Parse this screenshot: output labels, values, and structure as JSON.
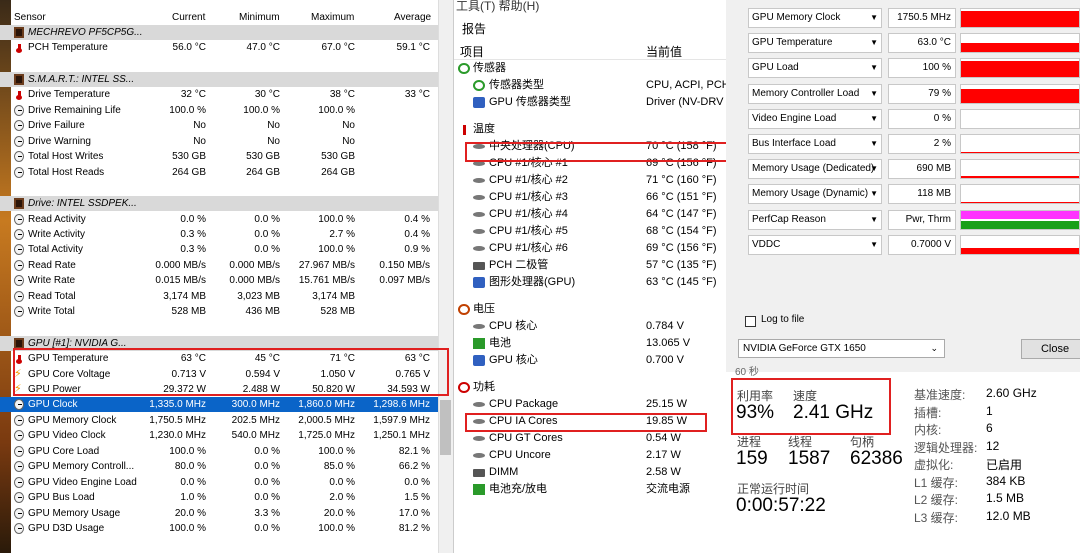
{
  "hwinfo": {
    "headers": {
      "sensor": "Sensor",
      "current": "Current",
      "min": "Minimum",
      "max": "Maximum",
      "avg": "Average"
    },
    "rows": [
      {
        "type": "grp",
        "name": "MECHREVO PF5CP5G...",
        "icon": "device-icon"
      },
      {
        "type": "row",
        "name": "PCH Temperature",
        "icon": "thermometer-icon",
        "cur": "56.0 °C",
        "min": "47.0 °C",
        "max": "67.0 °C",
        "avg": "59.1 °C"
      },
      {
        "type": "grp",
        "name": "S.M.A.R.T.: INTEL SS...",
        "icon": "device-icon"
      },
      {
        "type": "row",
        "name": "Drive Temperature",
        "icon": "thermometer-icon",
        "cur": "32 °C",
        "min": "30 °C",
        "max": "38 °C",
        "avg": "33 °C"
      },
      {
        "type": "row",
        "name": "Drive Remaining Life",
        "icon": "gauge-icon",
        "cur": "100.0 %",
        "min": "100.0 %",
        "max": "100.0 %",
        "avg": ""
      },
      {
        "type": "row",
        "name": "Drive Failure",
        "icon": "gauge-icon",
        "cur": "No",
        "min": "No",
        "max": "No",
        "avg": ""
      },
      {
        "type": "row",
        "name": "Drive Warning",
        "icon": "gauge-icon",
        "cur": "No",
        "min": "No",
        "max": "No",
        "avg": ""
      },
      {
        "type": "row",
        "name": "Total Host Writes",
        "icon": "gauge-icon",
        "cur": "530 GB",
        "min": "530 GB",
        "max": "530 GB",
        "avg": ""
      },
      {
        "type": "row",
        "name": "Total Host Reads",
        "icon": "gauge-icon",
        "cur": "264 GB",
        "min": "264 GB",
        "max": "264 GB",
        "avg": ""
      },
      {
        "type": "grp",
        "name": "Drive: INTEL SSDPEK...",
        "icon": "device-icon"
      },
      {
        "type": "row",
        "name": "Read Activity",
        "icon": "gauge-icon",
        "cur": "0.0 %",
        "min": "0.0 %",
        "max": "100.0 %",
        "avg": "0.4 %"
      },
      {
        "type": "row",
        "name": "Write Activity",
        "icon": "gauge-icon",
        "cur": "0.3 %",
        "min": "0.0 %",
        "max": "2.7 %",
        "avg": "0.4 %"
      },
      {
        "type": "row",
        "name": "Total Activity",
        "icon": "gauge-icon",
        "cur": "0.3 %",
        "min": "0.0 %",
        "max": "100.0 %",
        "avg": "0.9 %"
      },
      {
        "type": "row",
        "name": "Read Rate",
        "icon": "gauge-icon",
        "cur": "0.000 MB/s",
        "min": "0.000 MB/s",
        "max": "27.967 MB/s",
        "avg": "0.150 MB/s"
      },
      {
        "type": "row",
        "name": "Write Rate",
        "icon": "gauge-icon",
        "cur": "0.015 MB/s",
        "min": "0.000 MB/s",
        "max": "15.761 MB/s",
        "avg": "0.097 MB/s"
      },
      {
        "type": "row",
        "name": "Read Total",
        "icon": "gauge-icon",
        "cur": "3,174 MB",
        "min": "3,023 MB",
        "max": "3,174 MB",
        "avg": ""
      },
      {
        "type": "row",
        "name": "Write Total",
        "icon": "gauge-icon",
        "cur": "528 MB",
        "min": "436 MB",
        "max": "528 MB",
        "avg": ""
      },
      {
        "type": "grp",
        "name": "GPU [#1]: NVIDIA G...",
        "icon": "device-icon"
      },
      {
        "type": "row",
        "name": "GPU Temperature",
        "icon": "thermometer-icon",
        "cur": "63 °C",
        "min": "45 °C",
        "max": "71 °C",
        "avg": "63 °C"
      },
      {
        "type": "row",
        "name": "GPU Core Voltage",
        "icon": "bolt-icon",
        "cur": "0.713 V",
        "min": "0.594 V",
        "max": "1.050 V",
        "avg": "0.765 V"
      },
      {
        "type": "row",
        "name": "GPU Power",
        "icon": "bolt-icon",
        "cur": "29.372 W",
        "min": "2.488 W",
        "max": "50.820 W",
        "avg": "34.593 W"
      },
      {
        "type": "sel",
        "name": "GPU Clock",
        "icon": "gauge-icon",
        "cur": "1,335.0 MHz",
        "min": "300.0 MHz",
        "max": "1,860.0 MHz",
        "avg": "1,298.6 MHz"
      },
      {
        "type": "row",
        "name": "GPU Memory Clock",
        "icon": "gauge-icon",
        "cur": "1,750.5 MHz",
        "min": "202.5 MHz",
        "max": "2,000.5 MHz",
        "avg": "1,597.9 MHz"
      },
      {
        "type": "row",
        "name": "GPU Video Clock",
        "icon": "gauge-icon",
        "cur": "1,230.0 MHz",
        "min": "540.0 MHz",
        "max": "1,725.0 MHz",
        "avg": "1,250.1 MHz"
      },
      {
        "type": "row",
        "name": "GPU Core Load",
        "icon": "gauge-icon",
        "cur": "100.0 %",
        "min": "0.0 %",
        "max": "100.0 %",
        "avg": "82.1 %"
      },
      {
        "type": "row",
        "name": "GPU Memory Controll...",
        "icon": "gauge-icon",
        "cur": "80.0 %",
        "min": "0.0 %",
        "max": "85.0 %",
        "avg": "66.2 %"
      },
      {
        "type": "row",
        "name": "GPU Video Engine Load",
        "icon": "gauge-icon",
        "cur": "0.0 %",
        "min": "0.0 %",
        "max": "0.0 %",
        "avg": "0.0 %"
      },
      {
        "type": "row",
        "name": "GPU Bus Load",
        "icon": "gauge-icon",
        "cur": "1.0 %",
        "min": "0.0 %",
        "max": "2.0 %",
        "avg": "1.5 %"
      },
      {
        "type": "row",
        "name": "GPU Memory Usage",
        "icon": "gauge-icon",
        "cur": "20.0 %",
        "min": "3.3 %",
        "max": "20.0 %",
        "avg": "17.0 %"
      },
      {
        "type": "row",
        "name": "GPU D3D Usage",
        "icon": "gauge-icon",
        "cur": "100.0 %",
        "min": "0.0 %",
        "max": "100.0 %",
        "avg": "81.2 %"
      }
    ]
  },
  "aida": {
    "menu": "工具(T)  帮助(H)",
    "report": "报告",
    "col_item": "项目",
    "col_value": "当前值",
    "rows": [
      {
        "indent": 0,
        "icon": "sensor-icon",
        "k": "传感器",
        "v": ""
      },
      {
        "indent": 1,
        "icon": "sensor-type-icon",
        "k": "传感器类型",
        "v": "CPU, ACPI, PCH,"
      },
      {
        "indent": 1,
        "icon": "gpu-icon",
        "k": "GPU 传感器类型",
        "v": "Driver  (NV-DRV"
      },
      {
        "indent": 0,
        "icon": "thermometer-icon",
        "k": "温度",
        "v": "",
        "gap": true
      },
      {
        "indent": 1,
        "icon": "cpu-icon",
        "k": "中央处理器(CPU)",
        "v": "70 °C  (158 °F)"
      },
      {
        "indent": 1,
        "icon": "cpu-icon",
        "k": "CPU #1/核心 #1",
        "v": "69 °C  (156 °F)"
      },
      {
        "indent": 1,
        "icon": "cpu-icon",
        "k": "CPU #1/核心 #2",
        "v": "71 °C  (160 °F)"
      },
      {
        "indent": 1,
        "icon": "cpu-icon",
        "k": "CPU #1/核心 #3",
        "v": "66 °C  (151 °F)"
      },
      {
        "indent": 1,
        "icon": "cpu-icon",
        "k": "CPU #1/核心 #4",
        "v": "64 °C  (147 °F)"
      },
      {
        "indent": 1,
        "icon": "cpu-icon",
        "k": "CPU #1/核心 #5",
        "v": "68 °C  (154 °F)"
      },
      {
        "indent": 1,
        "icon": "cpu-icon",
        "k": "CPU #1/核心 #6",
        "v": "69 °C  (156 °F)"
      },
      {
        "indent": 1,
        "icon": "chip-icon",
        "k": "PCH 二极管",
        "v": "57 °C  (135 °F)"
      },
      {
        "indent": 1,
        "icon": "gpu-icon",
        "k": "图形处理器(GPU)",
        "v": "63 °C  (145 °F)"
      },
      {
        "indent": 0,
        "icon": "voltage-icon",
        "k": "电压",
        "v": "",
        "gap": true
      },
      {
        "indent": 1,
        "icon": "cpu-icon",
        "k": "CPU 核心",
        "v": "0.784 V"
      },
      {
        "indent": 1,
        "icon": "battery-icon",
        "k": "电池",
        "v": "13.065 V"
      },
      {
        "indent": 1,
        "icon": "gpu-icon",
        "k": "GPU 核心",
        "v": "0.700 V"
      },
      {
        "indent": 0,
        "icon": "power-icon",
        "k": "功耗",
        "v": "",
        "gap": true
      },
      {
        "indent": 1,
        "icon": "cpu-icon",
        "k": "CPU Package",
        "v": "25.15 W"
      },
      {
        "indent": 1,
        "icon": "cpu-icon",
        "k": "CPU IA Cores",
        "v": "19.85 W"
      },
      {
        "indent": 1,
        "icon": "cpu-icon",
        "k": "CPU GT Cores",
        "v": "0.54 W"
      },
      {
        "indent": 1,
        "icon": "cpu-icon",
        "k": "CPU Uncore",
        "v": "2.17 W"
      },
      {
        "indent": 1,
        "icon": "dimm-icon",
        "k": "DIMM",
        "v": "2.58 W"
      },
      {
        "indent": 1,
        "icon": "battery-icon",
        "k": "电池充/放电",
        "v": "交流电源"
      }
    ]
  },
  "gpuz": {
    "rows": [
      {
        "label": "GPU Memory Clock",
        "value": "1750.5 MHz",
        "color": "#ff0000",
        "level": 0.9
      },
      {
        "label": "GPU Temperature",
        "value": "63.0 °C",
        "color": "#ff0000",
        "level": 0.5
      },
      {
        "label": "GPU Load",
        "value": "100 %",
        "color": "#ff0000",
        "level": 0.9
      },
      {
        "label": "Memory Controller Load",
        "value": "79 %",
        "color": "#ff0000",
        "level": 0.75
      },
      {
        "label": "Video Engine Load",
        "value": "0 %",
        "color": "#ff0000",
        "level": 0
      },
      {
        "label": "Bus Interface Load",
        "value": "2 %",
        "color": "#ff0000",
        "level": 0.05
      },
      {
        "label": "Memory Usage (Dedicated)",
        "value": "690 MB",
        "color": "#ff0000",
        "level": 0.15
      },
      {
        "label": "Memory Usage (Dynamic)",
        "value": "118 MB",
        "color": "#ff0000",
        "level": 0.08
      },
      {
        "label": "PerfCap Reason",
        "value": "Pwr, Thrm",
        "color": "#ff33ff",
        "level": 1
      },
      {
        "label": "VDDC",
        "value": "0.7000 V",
        "color": "#ff0000",
        "level": 0.3
      }
    ],
    "log_label": "Log to file",
    "gpu_select": "NVIDIA GeForce GTX 1650",
    "close_label": "Close"
  },
  "taskmgr": {
    "top_cut": "60 秒",
    "util_label": "利用率",
    "util_value": "93%",
    "speed_label": "速度",
    "speed_value": "2.41 GHz",
    "proc_label": "进程",
    "proc_value": "159",
    "thread_label": "线程",
    "thread_value": "1587",
    "handle_label": "句柄",
    "handle_value": "62386",
    "uptime_label": "正常运行时间",
    "uptime_value": "0:00:57:22",
    "specs": [
      {
        "k": "基准速度:",
        "v": "2.60 GHz"
      },
      {
        "k": "插槽:",
        "v": "1"
      },
      {
        "k": "内核:",
        "v": "6"
      },
      {
        "k": "逻辑处理器:",
        "v": "12"
      },
      {
        "k": "虚拟化:",
        "v": "已启用"
      },
      {
        "k": "L1 缓存:",
        "v": "384 KB"
      },
      {
        "k": "L2 缓存:",
        "v": "1.5 MB"
      },
      {
        "k": "L3 缓存:",
        "v": "12.0 MB"
      }
    ]
  }
}
